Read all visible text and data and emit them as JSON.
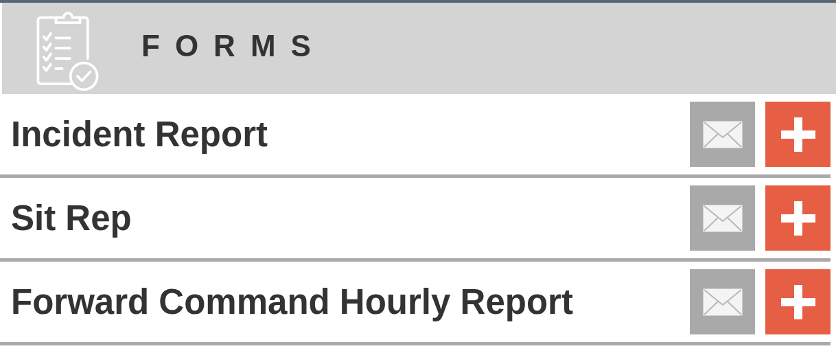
{
  "header": {
    "title": "FORMS"
  },
  "forms": [
    {
      "name": "Incident Report"
    },
    {
      "name": "Sit Rep"
    },
    {
      "name": "Forward Command Hourly Report"
    }
  ]
}
